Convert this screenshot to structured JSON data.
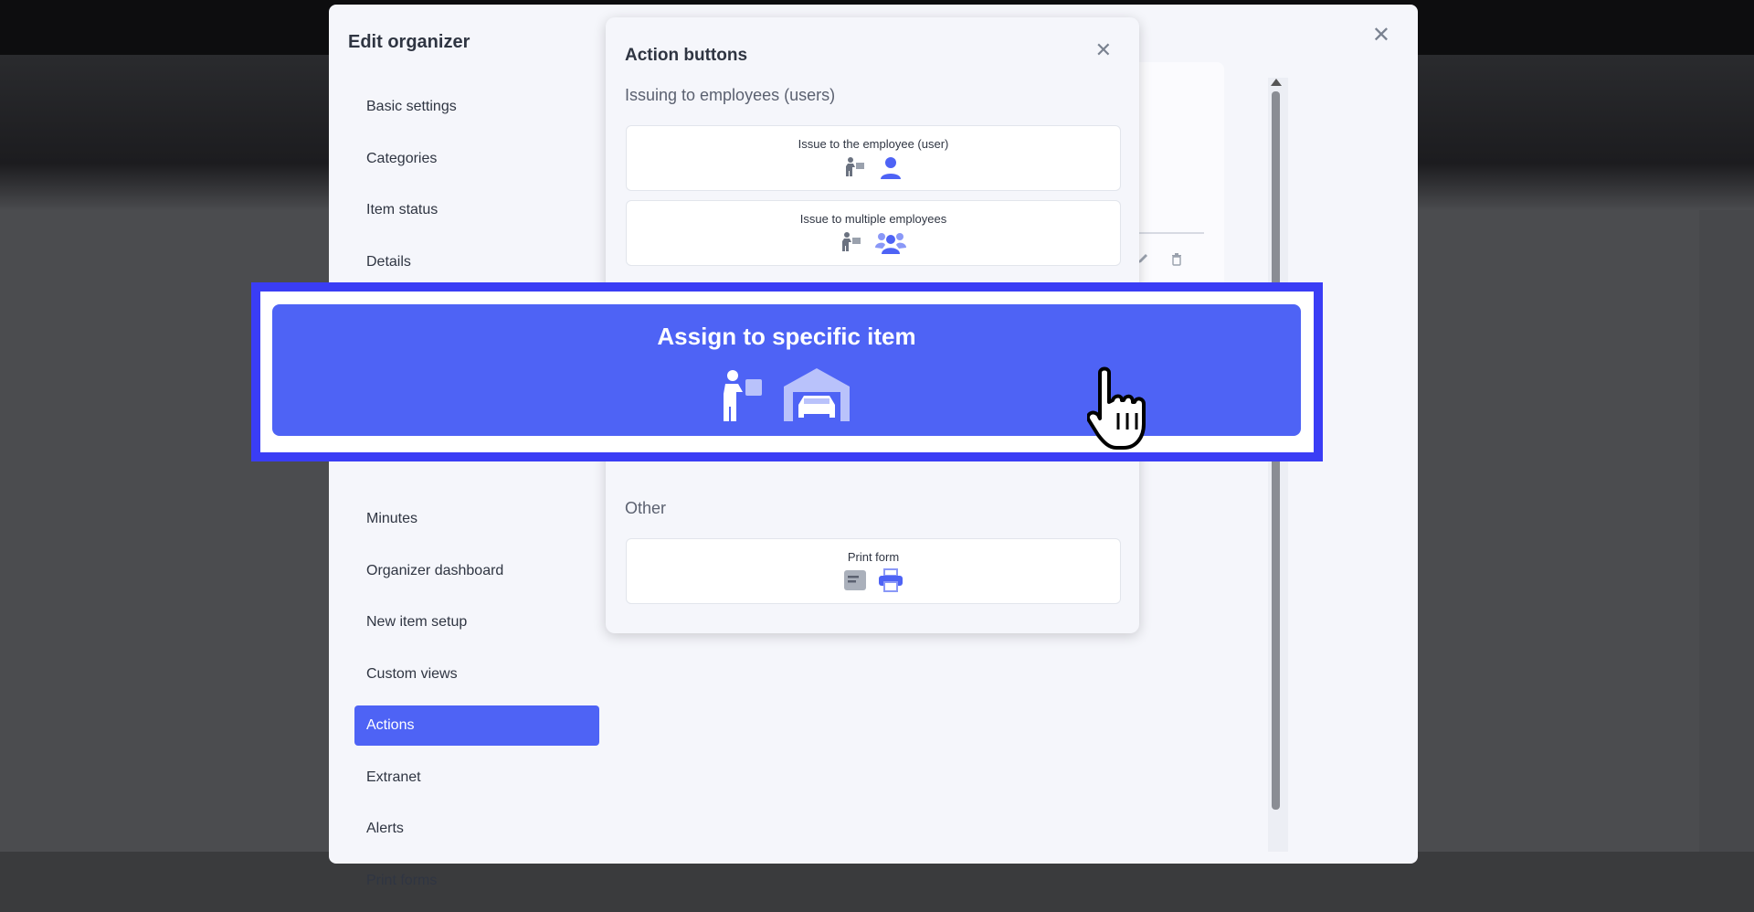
{
  "modal": {
    "title": "Edit organizer",
    "close_glyph": "✕",
    "menu": [
      {
        "label": "Basic settings",
        "active": false
      },
      {
        "label": "Categories",
        "active": false
      },
      {
        "label": "Item status",
        "active": false
      },
      {
        "label": "Details",
        "active": false
      },
      {
        "label": "Minutes",
        "active": false
      },
      {
        "label": "Organizer dashboard",
        "active": false
      },
      {
        "label": "New item setup",
        "active": false
      },
      {
        "label": "Custom views",
        "active": false
      },
      {
        "label": "Actions",
        "active": true
      },
      {
        "label": "Extranet",
        "active": false
      },
      {
        "label": "Alerts",
        "active": false
      },
      {
        "label": "Print forms",
        "active": false
      }
    ]
  },
  "popup": {
    "title": "Action buttons",
    "close_glyph": "✕",
    "section_issuing": "Issuing to employees (users)",
    "buttons": [
      {
        "label": "Issue to the employee (user)",
        "icons": [
          "carry-box-icon",
          "user-icon"
        ]
      },
      {
        "label": "Issue to multiple employees",
        "icons": [
          "carry-box-icon",
          "users-group-icon"
        ]
      }
    ],
    "section_other": "Other",
    "other_buttons": [
      {
        "label": "Print form",
        "icons": [
          "form-document-icon",
          "printer-icon"
        ]
      }
    ]
  },
  "highlight": {
    "label": "Assign to specific item",
    "icons": [
      "carry-box-icon",
      "garage-car-icon"
    ]
  },
  "colors": {
    "accent": "#4e63f5",
    "highlight_border": "#3a3df5",
    "icon_gray": "#6b7280",
    "icon_blue": "#4e63f5"
  }
}
